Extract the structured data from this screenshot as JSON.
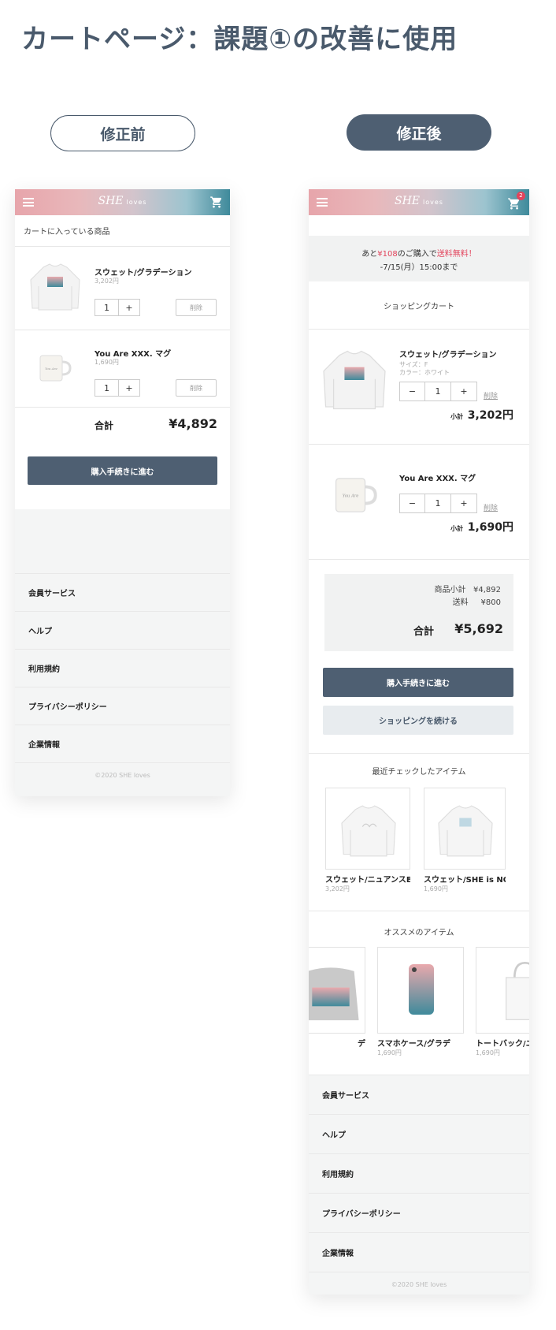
{
  "page": {
    "title": "カートページ：課題①の改善に使用"
  },
  "labels": {
    "before": "修正前",
    "after": "修正後"
  },
  "brand": {
    "logo_main": "SHE",
    "logo_sub": "loves",
    "cart_badge": "2"
  },
  "colors": {
    "accent_dark": "#4e5f72",
    "title_color": "#4a5a6c",
    "highlight_red": "#e2445c",
    "header_gradient_start": "#e7a5ab",
    "header_gradient_end": "#3f8a9b"
  },
  "before": {
    "cart_title": "カートに入っている商品",
    "items": [
      {
        "name": "スウェット/グラデーション",
        "price": "3,202円",
        "qty": "1",
        "delete": "削除"
      },
      {
        "name": "You Are XXX. マグ",
        "price": "1,690円",
        "qty": "1",
        "delete": "削除"
      }
    ],
    "total_label": "合計",
    "total_value": "¥4,892",
    "checkout": "購入手続きに進む"
  },
  "after": {
    "shipping_notice_prefix": "あと",
    "shipping_notice_amount": "¥108",
    "shipping_notice_mid": "のご購入で",
    "shipping_notice_free": "送料無料！",
    "shipping_deadline": "-7/15(月）15:00まで",
    "cart_title": "ショッピングカート",
    "items": [
      {
        "name": "スウェット/グラデーション",
        "size": "サイズ：F",
        "color": "カラー：ホワイト",
        "qty": "1",
        "delete": "削除",
        "subtotal_label": "小計",
        "subtotal": "3,202円"
      },
      {
        "name": "You Are XXX. マグ",
        "qty": "1",
        "delete": "削除",
        "subtotal_label": "小計",
        "subtotal": "1,690円"
      }
    ],
    "summary": {
      "subtotal_label": "商品小計",
      "subtotal_value": "¥4,892",
      "shipping_label": "送料",
      "shipping_value": "¥800",
      "total_label": "合計",
      "total_value": "¥5,692"
    },
    "checkout": "購入手続きに進む",
    "continue": "ショッピングを続ける",
    "recent_title": "最近チェックしたアイテム",
    "recent": [
      {
        "name": "スウェット/ニュアンスB",
        "price": "3,202円"
      },
      {
        "name": "スウェット/SHE is NO",
        "price": "1,690円"
      }
    ],
    "recommend_title": "オススメのアイテム",
    "recommend": [
      {
        "name": "デ"
      },
      {
        "name": "スマホケース/グラデ",
        "price": "1,690円"
      },
      {
        "name": "トートバック/ニ",
        "price": "1,690円"
      }
    ]
  },
  "footer": {
    "items": [
      "会員サービス",
      "ヘルプ",
      "利用規約",
      "プライバシーポリシー",
      "企業情報"
    ],
    "copyright": "©2020 SHE loves"
  },
  "icons": {
    "menu": "hamburger-menu-icon",
    "cart": "cart-icon",
    "plus": "plus-icon",
    "minus": "minus-icon"
  }
}
